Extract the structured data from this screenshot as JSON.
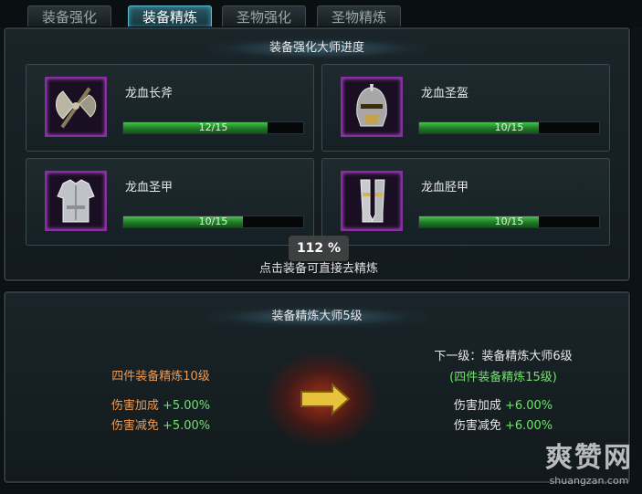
{
  "tabs": [
    "装备强化",
    "装备精炼",
    "圣物强化",
    "圣物精炼"
  ],
  "top_panel": {
    "title": "装备强化大师进度",
    "hint": "点击装备可直接去精炼",
    "items": [
      {
        "name": "龙血长斧",
        "progress_text": "12/15",
        "progress": 0.8
      },
      {
        "name": "龙血圣盔",
        "progress_text": "10/15",
        "progress": 0.667
      },
      {
        "name": "龙血圣甲",
        "progress_text": "10/15",
        "progress": 0.667
      },
      {
        "name": "龙血胫甲",
        "progress_text": "10/15",
        "progress": 0.667
      }
    ]
  },
  "zoom": "112 %",
  "bottom_panel": {
    "title": "装备精炼大师5级",
    "current": {
      "requirement": "四件装备精炼10级",
      "stats": [
        {
          "label": "伤害加成",
          "value": "+5.00%"
        },
        {
          "label": "伤害减免",
          "value": "+5.00%"
        }
      ]
    },
    "next": {
      "heading": "下一级：装备精炼大师6级",
      "requirement": "(四件装备精炼15级)",
      "stats": [
        {
          "label": "伤害加成",
          "value": "+6.00%"
        },
        {
          "label": "伤害减免",
          "value": "+6.00%"
        }
      ]
    }
  },
  "watermark": {
    "big": "爽赞网",
    "small": "shuangzan.com"
  },
  "colors": {
    "accent_tab": "#5fb9cc",
    "progress_green": "#49c24f",
    "item_border": "#8a2ea6",
    "current_text": "#f09a50",
    "bonus_green": "#6fe36a"
  },
  "icons": [
    "battle-axe-icon",
    "helmet-icon",
    "chest-armor-icon",
    "leg-armor-icon",
    "right-arrow-icon"
  ]
}
